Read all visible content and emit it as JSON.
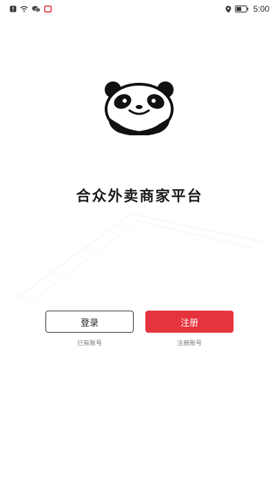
{
  "status_bar": {
    "time": "5:00",
    "left_icons": [
      "alert-icon",
      "wifi-icon",
      "wechat-icon",
      "app-notification-icon"
    ],
    "right_icons": [
      "location-icon",
      "battery-icon"
    ]
  },
  "app": {
    "title": "合众外卖商家平台",
    "logo": "panda-logo"
  },
  "actions": {
    "login_label": "登录",
    "login_caption": "已有账号",
    "register_label": "注册",
    "register_caption": "注册账号"
  },
  "colors": {
    "primary": "#e6343f",
    "title": "#1a1a1a",
    "caption": "#777777"
  }
}
